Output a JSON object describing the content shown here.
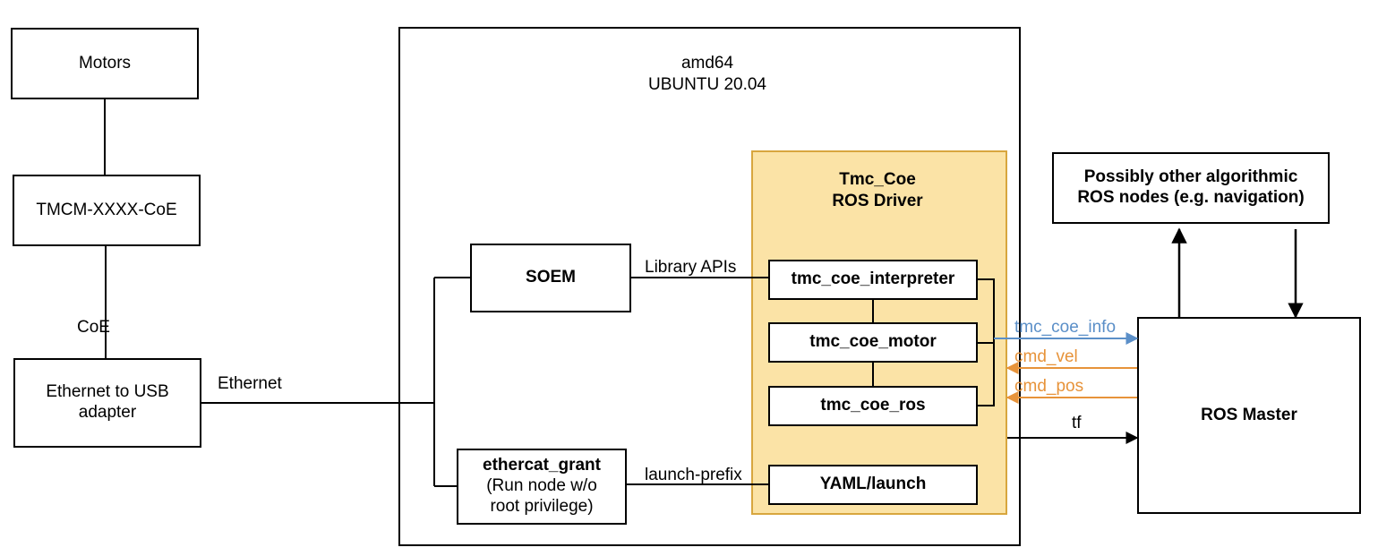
{
  "left": {
    "motors": "Motors",
    "tmcm": "TMCM-XXXX-CoE",
    "coe_label": "CoE",
    "adapter": "Ethernet to USB\nadapter",
    "ethernet_label": "Ethernet"
  },
  "host": {
    "title_line1": "amd64",
    "title_line2": "UBUNTU 20.04",
    "soem": "SOEM",
    "library_apis": "Library APIs",
    "ethercat_grant_title": "ethercat_grant",
    "ethercat_grant_sub1": "(Run node w/o",
    "ethercat_grant_sub2": "root privilege)",
    "launch_prefix": "launch-prefix"
  },
  "driver": {
    "title_line1": "Tmc_Coe",
    "title_line2": "ROS Driver",
    "interpreter": "tmc_coe_interpreter",
    "motor": "tmc_coe_motor",
    "ros": "tmc_coe_ros",
    "yaml": "YAML/launch"
  },
  "topics": {
    "info": "tmc_coe_info",
    "cmd_vel": "cmd_vel",
    "cmd_pos": "cmd_pos",
    "tf": "tf"
  },
  "right": {
    "other_nodes": "Possibly other algorithmic\nROS nodes (e.g. navigation)",
    "ros_master": "ROS Master"
  }
}
